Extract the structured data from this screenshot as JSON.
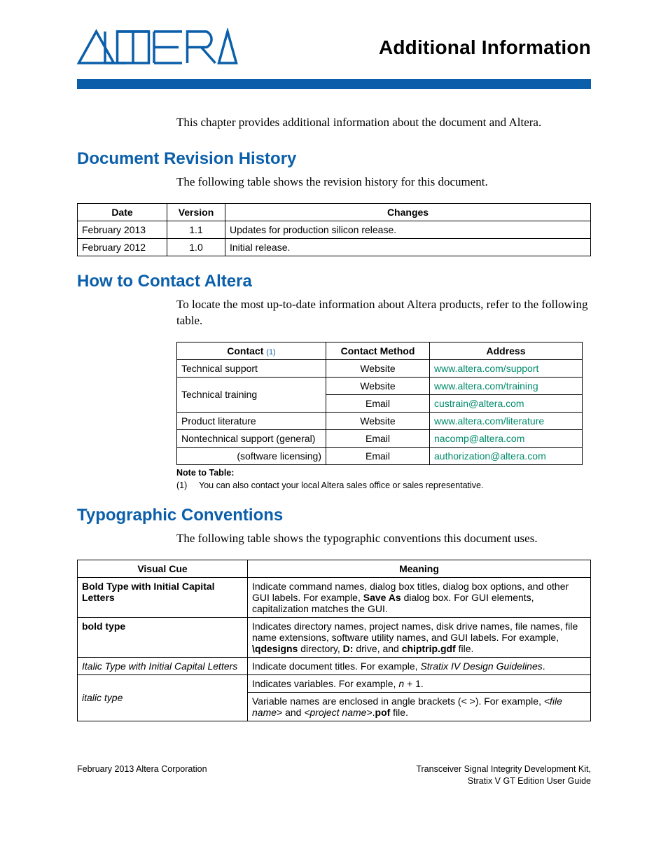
{
  "header": {
    "title": "Additional Information",
    "logo_alt": "Altera"
  },
  "intro": "This chapter provides additional information about the document and Altera.",
  "revision": {
    "heading": "Document Revision History",
    "intro": "The following table shows the revision history for this document.",
    "cols": {
      "date": "Date",
      "version": "Version",
      "changes": "Changes"
    },
    "rows": [
      {
        "date": "February 2013",
        "version": "1.1",
        "changes": "Updates for production silicon release."
      },
      {
        "date": "February 2012",
        "version": "1.0",
        "changes": "Initial release."
      }
    ]
  },
  "contact": {
    "heading": "How to Contact Altera",
    "intro": "To locate the most up-to-date information about Altera products, refer to the following table.",
    "cols": {
      "contact": "Contact",
      "ref": "(1)",
      "method": "Contact Method",
      "address": "Address"
    },
    "rows": [
      {
        "contact": "Technical support",
        "method": "Website",
        "address": "www.altera.com/support",
        "link": true
      },
      {
        "contact": "Technical training",
        "method": "Website",
        "address": "www.altera.com/training",
        "link": true,
        "rowspan": 2
      },
      {
        "contact": "",
        "method": "Email",
        "address": "custrain@altera.com",
        "link": true
      },
      {
        "contact": "Product literature",
        "method": "Website",
        "address": "www.altera.com/literature",
        "link": true
      },
      {
        "contact": "Nontechnical support (general)",
        "method": "Email",
        "address": "nacomp@altera.com",
        "link": true
      },
      {
        "contact": "(software licensing)",
        "align": "right",
        "method": "Email",
        "address": "authorization@altera.com",
        "link": true
      }
    ],
    "note_title": "Note to Table:",
    "note_num": "(1)",
    "note_text": "You can also contact your local Altera sales office or sales representative."
  },
  "typo": {
    "heading": "Typographic Conventions",
    "intro": "The following table shows the typographic conventions this document uses.",
    "cols": {
      "cue": "Visual Cue",
      "meaning": "Meaning"
    },
    "rows": {
      "r1": {
        "cue": "Bold Type with Initial Capital Letters",
        "m_pre": "Indicate command names, dialog box titles, dialog box options, and other GUI labels. For example, ",
        "m_b1": "Save As",
        "m_post": " dialog box. For GUI elements, capitalization matches the GUI."
      },
      "r2": {
        "cue": "bold type",
        "m_pre": "Indicates directory names, project names, disk drive names, file names, file name extensions, software utility names, and GUI labels. For example, ",
        "m_b1": "\\qdesigns",
        "m_mid1": " directory, ",
        "m_b2": "D:",
        "m_mid2": " drive, and ",
        "m_b3": "chiptrip.gdf",
        "m_post": " file."
      },
      "r3": {
        "cue": "Italic Type with Initial Capital Letters",
        "m_pre": "Indicate document titles. For example, ",
        "m_i1": "Stratix IV Design Guidelines",
        "m_post": "."
      },
      "r4": {
        "cue": "italic type",
        "m_line1_pre": "Indicates variables. For example, ",
        "m_line1_i": "n",
        "m_line1_post": " + 1.",
        "m_line2_pre": "Variable names are enclosed in angle brackets (< >). For example, ",
        "m_line2_i1": "<file name>",
        "m_line2_mid": " and ",
        "m_line2_i2": "<project name>",
        "m_line2_post1": ".",
        "m_line2_b": "pof",
        "m_line2_post2": " file."
      }
    }
  },
  "footer": {
    "left": "February 2013   Altera Corporation",
    "right1": "Transceiver Signal Integrity Development Kit,",
    "right2": "Stratix V GT Edition User Guide"
  }
}
